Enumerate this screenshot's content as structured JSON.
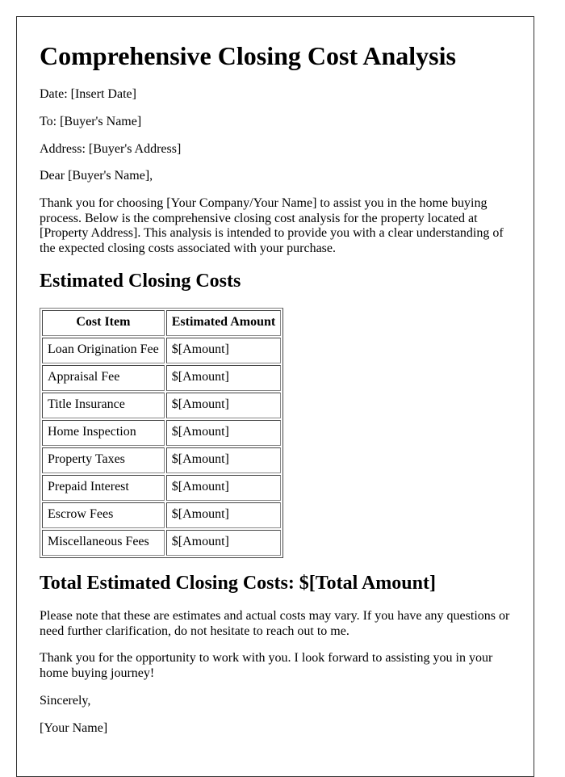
{
  "document": {
    "title": "Comprehensive Closing Cost Analysis",
    "date_line": "Date: [Insert Date]",
    "to_line": "To: [Buyer's Name]",
    "address_line": "Address: [Buyer's Address]",
    "salutation": "Dear [Buyer's Name],",
    "intro_paragraph": "Thank you for choosing [Your Company/Your Name] to assist you in the home buying process. Below is the comprehensive closing cost analysis for the property located at [Property Address]. This analysis is intended to provide you with a clear understanding of the expected closing costs associated with your purchase.",
    "costs_heading": "Estimated Closing Costs",
    "table": {
      "headers": [
        "Cost Item",
        "Estimated Amount"
      ],
      "rows": [
        {
          "item": "Loan Origination Fee",
          "amount": "$[Amount]"
        },
        {
          "item": "Appraisal Fee",
          "amount": "$[Amount]"
        },
        {
          "item": "Title Insurance",
          "amount": "$[Amount]"
        },
        {
          "item": "Home Inspection",
          "amount": "$[Amount]"
        },
        {
          "item": "Property Taxes",
          "amount": "$[Amount]"
        },
        {
          "item": "Prepaid Interest",
          "amount": "$[Amount]"
        },
        {
          "item": "Escrow Fees",
          "amount": "$[Amount]"
        },
        {
          "item": "Miscellaneous Fees",
          "amount": "$[Amount]"
        }
      ]
    },
    "total_heading": "Total Estimated Closing Costs: $[Total Amount]",
    "note_paragraph": "Please note that these are estimates and actual costs may vary. If you have any questions or need further clarification, do not hesitate to reach out to me.",
    "thanks_paragraph": "Thank you for the opportunity to work with you. I look forward to assisting you in your home buying journey!",
    "closing": "Sincerely,",
    "signature": "[Your Name]"
  }
}
